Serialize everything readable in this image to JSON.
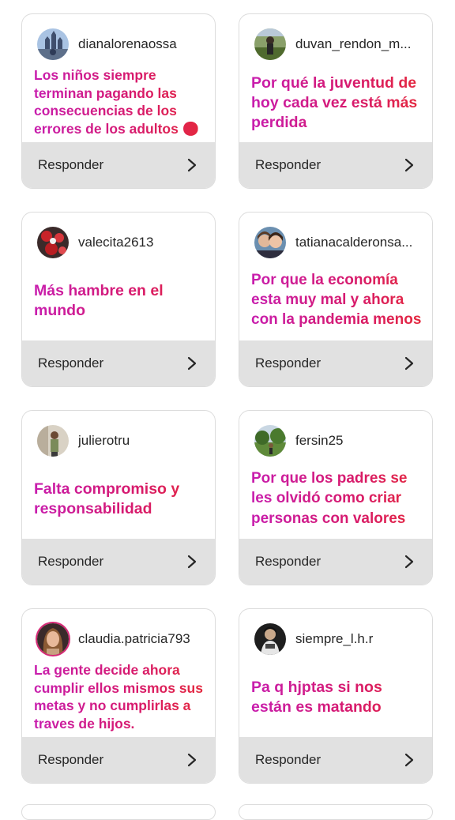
{
  "reply_label": "Responder",
  "accent_gradient": [
    "#c81dae",
    "#d81a6a",
    "#e5293b"
  ],
  "cards": [
    {
      "username": "dianalorenaossa",
      "question": "Los niños siempre terminan pagando las consecuencias de los errores de los adultos 😏",
      "avatar": "castle-photo"
    },
    {
      "username": "duvan_rendon_m...",
      "question": "Por qué la juventud de hoy cada vez está más perdida",
      "avatar": "outdoor-photo"
    },
    {
      "username": "valecita2613",
      "question": "Más hambre en el mundo",
      "avatar": "flowers-photo"
    },
    {
      "username": "tatianacalderonsa...",
      "question": "Por que la economía esta muy mal y  ahora con la pandemia menos",
      "avatar": "two-women-photo"
    },
    {
      "username": "julierotru",
      "question": "Falta compromiso y responsabilidad",
      "avatar": "person-photo"
    },
    {
      "username": "fersin25",
      "question": "Por que los padres se les olvidó como criar personas con valores",
      "avatar": "park-photo"
    },
    {
      "username": "claudia.patricia793",
      "question": "La gente decide ahora cumplir ellos mismos sus metas y no cumplirlas a traves de hijos.",
      "avatar": "woman-portrait-photo"
    },
    {
      "username": "siempre_l.h.r",
      "question": "Pa q hjptas si nos están es matando",
      "avatar": "dark-portrait-photo"
    }
  ]
}
